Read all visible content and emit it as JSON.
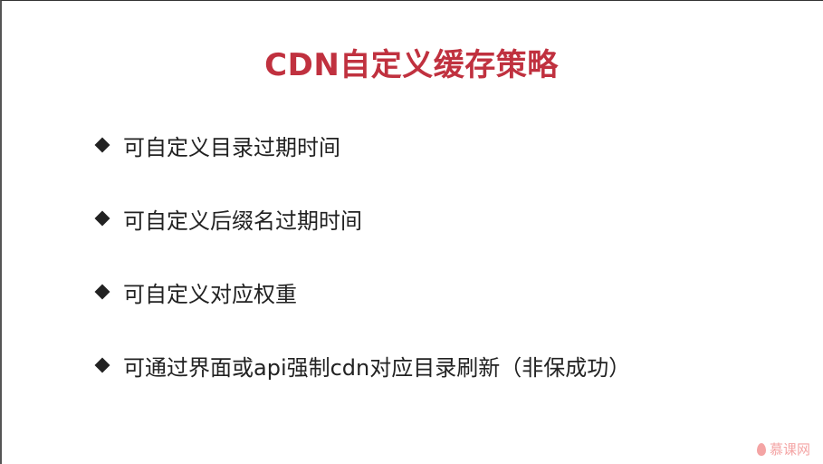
{
  "slide": {
    "title": "CDN自定义缓存策略",
    "bullets": [
      "可自定义目录过期时间",
      "可自定义后缀名过期时间",
      "可自定义对应权重",
      "可通过界面或api强制cdn对应目录刷新（非保成功）"
    ],
    "watermark": "慕课网"
  },
  "colors": {
    "title": "#c0313f",
    "text": "#222222",
    "watermark": "#f4a4a4"
  }
}
